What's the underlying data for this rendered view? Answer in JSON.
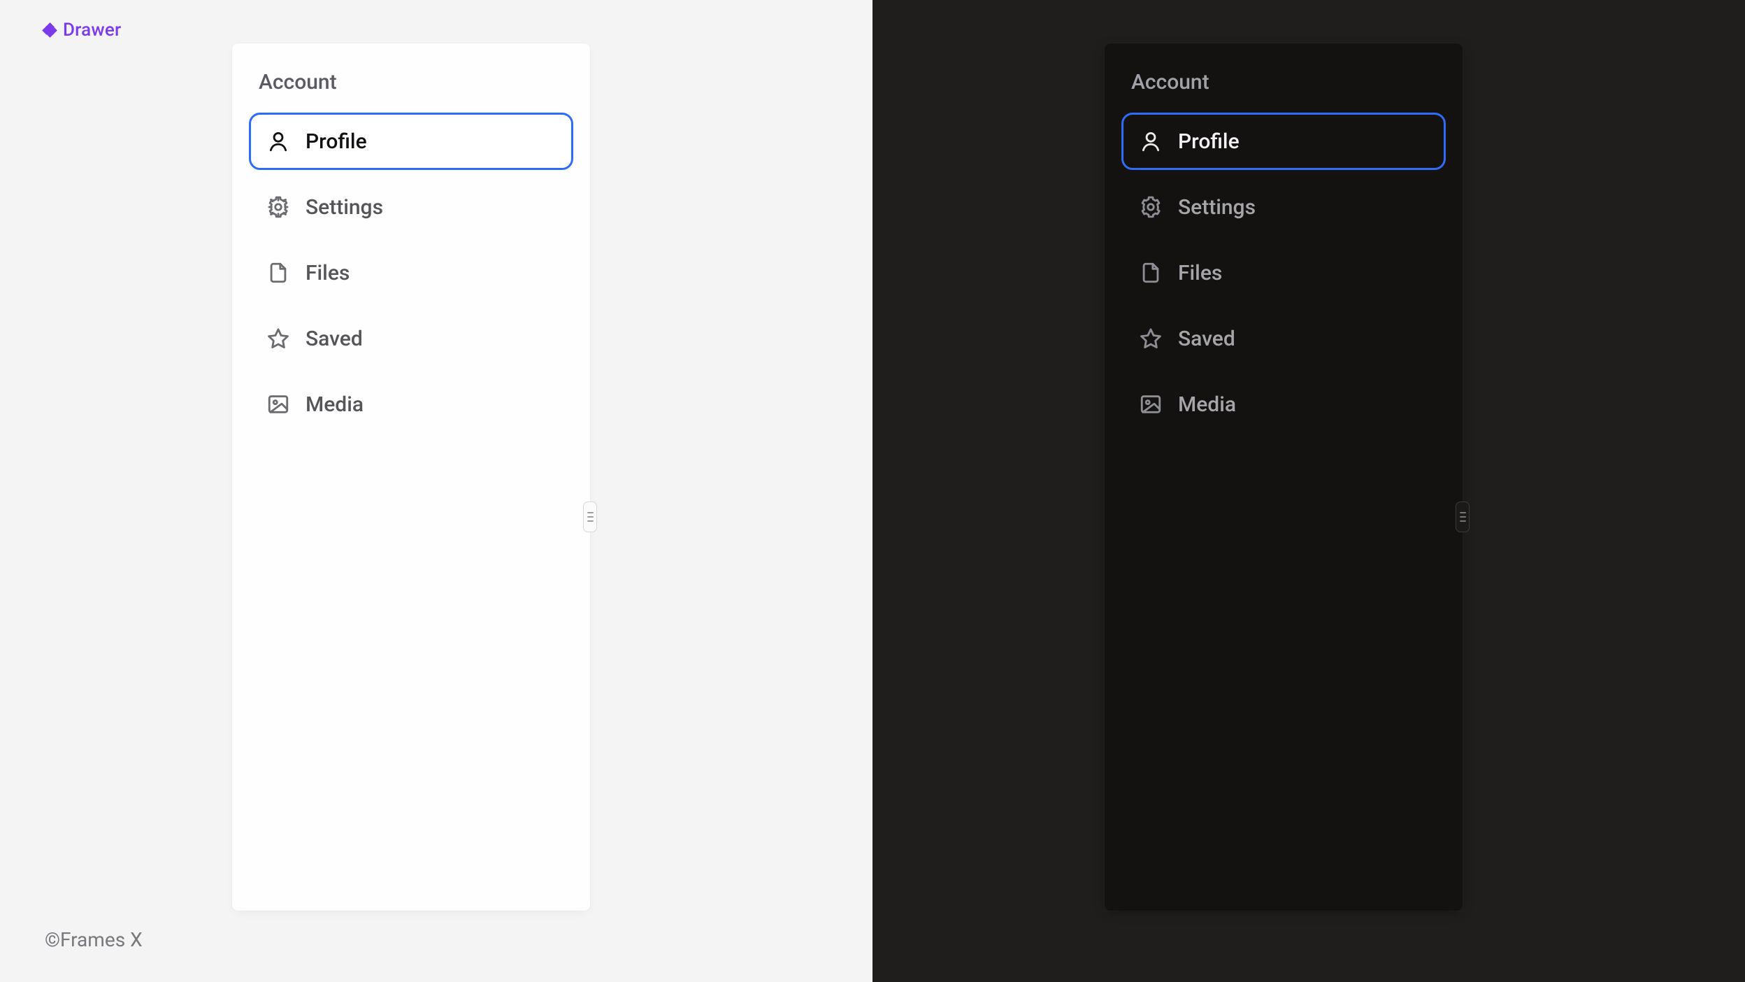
{
  "component_label": "Drawer",
  "copyright": "©Frames X",
  "accent_color": "#2f6cf6",
  "brand_color": "#7c3aed",
  "drawer": {
    "section_title": "Account",
    "items": [
      {
        "label": "Profile",
        "icon": "user-icon",
        "active": true
      },
      {
        "label": "Settings",
        "icon": "gear-icon",
        "active": false
      },
      {
        "label": "Files",
        "icon": "file-icon",
        "active": false
      },
      {
        "label": "Saved",
        "icon": "star-icon",
        "active": false
      },
      {
        "label": "Media",
        "icon": "image-icon",
        "active": false
      }
    ]
  }
}
